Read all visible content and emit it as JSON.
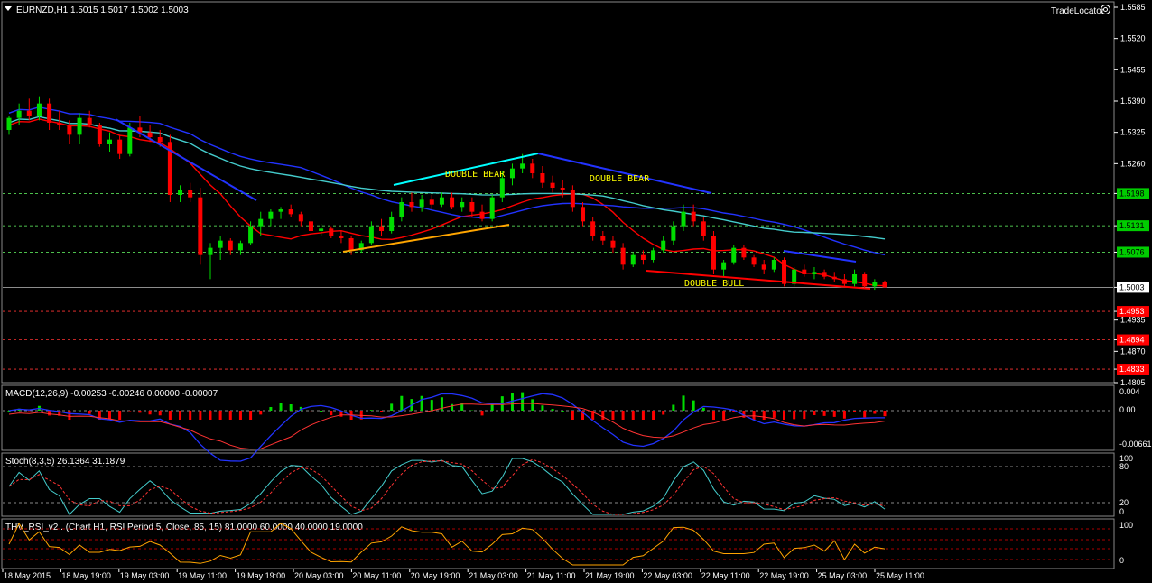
{
  "header": {
    "symbol_line": "EURNZD,H1  1.5015 1.5017 1.5002 1.5003",
    "tradelocator": "TradeLocator"
  },
  "price_axis": {
    "labels": [
      "1.5585",
      "1.5520",
      "1.5455",
      "1.5390",
      "1.5325",
      "1.5260",
      "1.5198",
      "1.5131",
      "1.5076",
      "1.5003",
      "1.4953",
      "1.4935",
      "1.4894",
      "1.4870",
      "1.4833",
      "1.4805"
    ],
    "boxes": [
      {
        "label": "1.5198",
        "color": "#00cc00",
        "text_color": "#000000"
      },
      {
        "label": "1.5131",
        "color": "#00cc00",
        "text_color": "#000000"
      },
      {
        "label": "1.5076",
        "color": "#00cc00",
        "text_color": "#000000"
      },
      {
        "label": "1.5003",
        "color": "#ffffff",
        "text_color": "#000000"
      },
      {
        "label": "1.4953",
        "color": "#ff0000",
        "text_color": "#ffffff"
      },
      {
        "label": "1.4894",
        "color": "#ff0000",
        "text_color": "#ffffff"
      },
      {
        "label": "1.4833",
        "color": "#ff0000",
        "text_color": "#ffffff"
      }
    ]
  },
  "annotations": [
    "DOUBLE BEAR",
    "DOUBLE BEAR",
    "DOUBLE BULL"
  ],
  "macd": {
    "header": "MACD(12,26,9) -0.00253 -0.00246 0.00000 -0.00007",
    "axis": [
      "0.004",
      "0.00",
      "0.00",
      "-0.00661"
    ]
  },
  "stoch": {
    "header": "Stoch(8,3,5) 26.1364 31.1879",
    "axis": [
      "100",
      "80",
      "20",
      "0"
    ]
  },
  "rsi": {
    "header": "THV_RSI_v2 . (Chart H1,  RSI Period 5,  Close,  85,  15)  81.0000 60.0000 40.0000 19.0000",
    "axis": [
      "100",
      "0"
    ]
  },
  "time_axis": [
    "18 May 2015",
    "18 May 19:00",
    "19 May 03:00",
    "19 May 11:00",
    "19 May 19:00",
    "20 May 03:00",
    "20 May 11:00",
    "20 May 19:00",
    "21 May 03:00",
    "21 May 11:00",
    "21 May 19:00",
    "22 May 03:00",
    "22 May 11:00",
    "22 May 19:00",
    "25 May 03:00",
    "25 May 11:00"
  ],
  "colors": {
    "bull": "#00dd00",
    "bear": "#ff0000",
    "ma_red": "#ff0000",
    "ma_blue": "#2233ff",
    "ma_cyan": "#44cccc",
    "trend_blue": "#2233ff",
    "trend_cyan": "#00ffff",
    "trend_orange": "#ffa500",
    "trend_red": "#ff0000",
    "grid": "#ffffff"
  },
  "chart_data": {
    "type": "candlestick",
    "symbol": "EURNZD",
    "timeframe": "H1",
    "ylim": [
      1.4805,
      1.5585
    ],
    "last": {
      "open": 1.5015,
      "high": 1.5017,
      "low": 1.5002,
      "close": 1.5003
    },
    "horizontal_levels": [
      1.5198,
      1.5131,
      1.5076,
      1.5003,
      1.4953,
      1.4894,
      1.4833
    ],
    "candles": [
      [
        1.533,
        1.536,
        1.532,
        1.5355
      ],
      [
        1.5355,
        1.5385,
        1.534,
        1.537
      ],
      [
        1.537,
        1.5395,
        1.535,
        1.536
      ],
      [
        1.536,
        1.54,
        1.535,
        1.5385
      ],
      [
        1.5385,
        1.5395,
        1.533,
        1.5345
      ],
      [
        1.5345,
        1.537,
        1.533,
        1.534
      ],
      [
        1.534,
        1.535,
        1.53,
        1.532
      ],
      [
        1.532,
        1.5365,
        1.53,
        1.5355
      ],
      [
        1.5355,
        1.537,
        1.5335,
        1.534
      ],
      [
        1.534,
        1.5345,
        1.5295,
        1.53
      ],
      [
        1.53,
        1.5325,
        1.5285,
        1.531
      ],
      [
        1.531,
        1.532,
        1.527,
        1.528
      ],
      [
        1.528,
        1.5345,
        1.5275,
        1.5335
      ],
      [
        1.5335,
        1.536,
        1.5315,
        1.5325
      ],
      [
        1.5325,
        1.534,
        1.5305,
        1.5315
      ],
      [
        1.5315,
        1.533,
        1.5295,
        1.5305
      ],
      [
        1.5305,
        1.532,
        1.518,
        1.5195
      ],
      [
        1.5195,
        1.5215,
        1.518,
        1.5205
      ],
      [
        1.5205,
        1.522,
        1.518,
        1.519
      ],
      [
        1.519,
        1.521,
        1.505,
        1.507
      ],
      [
        1.507,
        1.5095,
        1.502,
        1.5085
      ],
      [
        1.5085,
        1.511,
        1.506,
        1.51
      ],
      [
        1.51,
        1.5105,
        1.507,
        1.508
      ],
      [
        1.508,
        1.51,
        1.507,
        1.5095
      ],
      [
        1.5095,
        1.514,
        1.509,
        1.513
      ],
      [
        1.513,
        1.516,
        1.511,
        1.5145
      ],
      [
        1.5145,
        1.5165,
        1.513,
        1.516
      ],
      [
        1.516,
        1.517,
        1.5145,
        1.5165
      ],
      [
        1.5165,
        1.5175,
        1.515,
        1.5155
      ],
      [
        1.5155,
        1.516,
        1.513,
        1.514
      ],
      [
        1.514,
        1.515,
        1.511,
        1.512
      ],
      [
        1.512,
        1.5135,
        1.511,
        1.5125
      ],
      [
        1.5125,
        1.513,
        1.5105,
        1.511
      ],
      [
        1.511,
        1.512,
        1.5095,
        1.5105
      ],
      [
        1.5105,
        1.511,
        1.507,
        1.508
      ],
      [
        1.508,
        1.51,
        1.5075,
        1.5095
      ],
      [
        1.5095,
        1.514,
        1.509,
        1.513
      ],
      [
        1.513,
        1.5145,
        1.511,
        1.512
      ],
      [
        1.512,
        1.516,
        1.5115,
        1.515
      ],
      [
        1.515,
        1.519,
        1.514,
        1.518
      ],
      [
        1.518,
        1.52,
        1.516,
        1.517
      ],
      [
        1.517,
        1.5195,
        1.516,
        1.5185
      ],
      [
        1.5185,
        1.5195,
        1.5165,
        1.5175
      ],
      [
        1.5175,
        1.52,
        1.517,
        1.519
      ],
      [
        1.519,
        1.52,
        1.5165,
        1.517
      ],
      [
        1.517,
        1.519,
        1.516,
        1.518
      ],
      [
        1.518,
        1.519,
        1.515,
        1.516
      ],
      [
        1.516,
        1.5175,
        1.514,
        1.5145
      ],
      [
        1.5145,
        1.5195,
        1.514,
        1.519
      ],
      [
        1.519,
        1.5245,
        1.518,
        1.523
      ],
      [
        1.523,
        1.526,
        1.5215,
        1.525
      ],
      [
        1.525,
        1.528,
        1.524,
        1.526
      ],
      [
        1.526,
        1.527,
        1.523,
        1.524
      ],
      [
        1.524,
        1.5255,
        1.521,
        1.522
      ],
      [
        1.522,
        1.5235,
        1.52,
        1.521
      ],
      [
        1.521,
        1.5225,
        1.519,
        1.5205
      ],
      [
        1.5205,
        1.5215,
        1.516,
        1.517
      ],
      [
        1.517,
        1.518,
        1.513,
        1.514
      ],
      [
        1.514,
        1.515,
        1.51,
        1.511
      ],
      [
        1.511,
        1.512,
        1.509,
        1.51
      ],
      [
        1.51,
        1.511,
        1.5075,
        1.5085
      ],
      [
        1.5085,
        1.5095,
        1.504,
        1.505
      ],
      [
        1.505,
        1.5075,
        1.5045,
        1.507
      ],
      [
        1.507,
        1.508,
        1.505,
        1.506
      ],
      [
        1.506,
        1.5085,
        1.5055,
        1.508
      ],
      [
        1.508,
        1.511,
        1.5075,
        1.51
      ],
      [
        1.51,
        1.514,
        1.509,
        1.513
      ],
      [
        1.513,
        1.5175,
        1.512,
        1.516
      ],
      [
        1.516,
        1.5175,
        1.513,
        1.514
      ],
      [
        1.514,
        1.515,
        1.51,
        1.511
      ],
      [
        1.511,
        1.512,
        1.503,
        1.504
      ],
      [
        1.504,
        1.506,
        1.5025,
        1.5055
      ],
      [
        1.5055,
        1.509,
        1.505,
        1.5085
      ],
      [
        1.5085,
        1.509,
        1.506,
        1.5065
      ],
      [
        1.5065,
        1.507,
        1.5045,
        1.505
      ],
      [
        1.505,
        1.506,
        1.503,
        1.504
      ],
      [
        1.504,
        1.5065,
        1.5035,
        1.506
      ],
      [
        1.506,
        1.5065,
        1.5005,
        1.501
      ],
      [
        1.501,
        1.5045,
        1.5005,
        1.504
      ],
      [
        1.504,
        1.505,
        1.5025,
        1.503
      ],
      [
        1.503,
        1.5045,
        1.502,
        1.5035
      ],
      [
        1.5035,
        1.504,
        1.502,
        1.5025
      ],
      [
        1.5025,
        1.5035,
        1.5015,
        1.502
      ],
      [
        1.502,
        1.503,
        1.5005,
        1.501
      ],
      [
        1.501,
        1.504,
        1.5005,
        1.503
      ],
      [
        1.503,
        1.5035,
        1.5,
        1.5005
      ],
      [
        1.5005,
        1.502,
        1.4998,
        1.5015
      ],
      [
        1.5015,
        1.5017,
        1.5002,
        1.5003
      ]
    ],
    "macd_range": [
      -0.00661,
      0.004
    ],
    "stoch_range": [
      0,
      100
    ],
    "rsi_range": [
      0,
      100
    ]
  }
}
